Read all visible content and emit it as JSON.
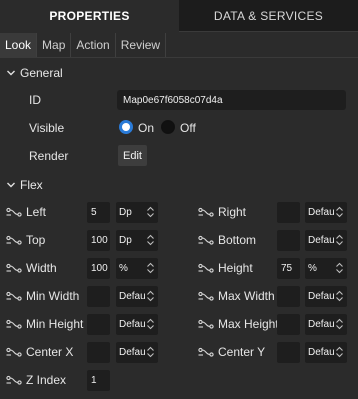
{
  "main_tabs": [
    {
      "label": "PROPERTIES"
    },
    {
      "label": "DATA & SERVICES"
    }
  ],
  "sub_tabs": [
    {
      "label": "Look"
    },
    {
      "label": "Map"
    },
    {
      "label": "Action"
    },
    {
      "label": "Review"
    }
  ],
  "general": {
    "heading": "General",
    "id_label": "ID",
    "id_value": "Map0e67f6058c07d4a",
    "visible_label": "Visible",
    "visible_on": "On",
    "visible_off": "Off",
    "visible_selected": "On",
    "render_label": "Render",
    "render_button": "Edit"
  },
  "flex": {
    "heading": "Flex",
    "left": {
      "label": "Left",
      "value": "5",
      "unit": "Dp"
    },
    "right": {
      "label": "Right",
      "value": "",
      "unit": "Defau"
    },
    "top": {
      "label": "Top",
      "value": "100",
      "unit": "Dp"
    },
    "bottom": {
      "label": "Bottom",
      "value": "",
      "unit": "Defau"
    },
    "width": {
      "label": "Width",
      "value": "100",
      "unit": "%"
    },
    "height": {
      "label": "Height",
      "value": "75",
      "unit": "%"
    },
    "min_width": {
      "label": "Min Width",
      "value": "",
      "unit": "Defau"
    },
    "max_width": {
      "label": "Max Width",
      "value": "",
      "unit": "Defau"
    },
    "min_height": {
      "label": "Min Height",
      "value": "",
      "unit": "Defau"
    },
    "max_height": {
      "label": "Max Height",
      "value": "",
      "unit": "Defau"
    },
    "center_x": {
      "label": "Center X",
      "value": "",
      "unit": "Defau"
    },
    "center_y": {
      "label": "Center Y",
      "value": "",
      "unit": "Defau"
    },
    "z_index": {
      "label": "Z Index",
      "value": "1"
    }
  },
  "colors": {
    "panel_bg": "#2b2b2b",
    "input_bg": "#1e1e1e",
    "accent": "#2a7bd8"
  }
}
